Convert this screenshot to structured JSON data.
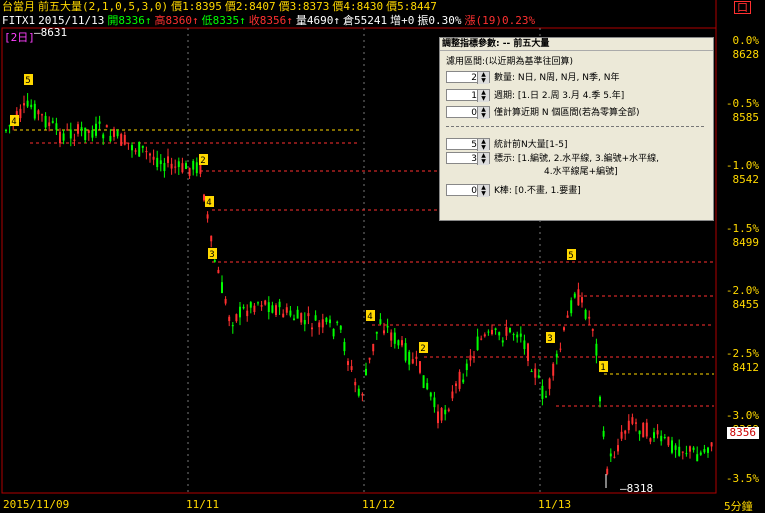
{
  "header": {
    "line1": [
      {
        "text": "台當月",
        "color": "#ffd800"
      },
      {
        "text": "前五大量(2,1,0,5,3,0)",
        "color": "#ffd800"
      },
      {
        "text": "價1:8395",
        "color": "#ffd800"
      },
      {
        "text": "價2:8407",
        "color": "#ffd800"
      },
      {
        "text": "價3:8373",
        "color": "#ffd800"
      },
      {
        "text": "價4:8430",
        "color": "#ffd800"
      },
      {
        "text": "價5:8447",
        "color": "#ffd800"
      }
    ],
    "line2": [
      {
        "text": "FITX1",
        "color": "#ffffff"
      },
      {
        "text": "2015/11/13",
        "color": "#ffffff"
      },
      {
        "text": "開8336↑",
        "color": "#00ff00"
      },
      {
        "text": "高8360↑",
        "color": "#ff3030"
      },
      {
        "text": "低8335↑",
        "color": "#00ff00"
      },
      {
        "text": "收8356↑",
        "color": "#ff3030"
      },
      {
        "text": "量4690↑",
        "color": "#ffffff"
      },
      {
        "text": "倉55241",
        "color": "#ffffff"
      },
      {
        "text": "增+0",
        "color": "#ffffff"
      },
      {
        "text": "振0.30%",
        "color": "#ffffff"
      },
      {
        "text": "漲(19)0.23%",
        "color": "#ff3030"
      }
    ],
    "tag": "[2日]",
    "high_mark": "8631"
  },
  "top_button": "口",
  "price_axis": [
    {
      "pct": "0.0%",
      "price": "8628"
    },
    {
      "pct": "-0.5%",
      "price": "8585"
    },
    {
      "pct": "-1.0%",
      "price": "8542"
    },
    {
      "pct": "-1.5%",
      "price": "8499"
    },
    {
      "pct": "-2.0%",
      "price": "8455"
    },
    {
      "pct": "-2.5%",
      "price": "8412"
    },
    {
      "pct": "-3.0%",
      "price": "8369"
    },
    {
      "pct": "-3.5%",
      "price": ""
    }
  ],
  "last_price": "8356",
  "low_mark": "8318",
  "x_axis": [
    "2015/11/09",
    "11/11",
    "11/12",
    "11/13"
  ],
  "timeframe": "5分鐘",
  "dialog": {
    "title": "調整指標參數: -- 前五大量",
    "section": "濾用區間:(以近期為基準往回算)",
    "params": [
      {
        "value": "2",
        "label": "數量: N日, N周, N月, N季, N年"
      },
      {
        "value": "1",
        "label": "週期: [1.日 2.周 3.月 4.季 5.年]"
      },
      {
        "value": "0",
        "label": "僅計算近期 N 個區間(若為零算全部)"
      },
      {
        "value": "5",
        "label": "統計前N大量[1-5]"
      },
      {
        "value": "3",
        "label": "標示: [1.編號, 2.水平線, 3.編號+水平線,"
      },
      {
        "value": "0",
        "label": "K棒: [0.不畫, 1.要畫]"
      }
    ],
    "param5_cont": "4.水平線尾+編號]"
  },
  "markers": [
    "1",
    "2",
    "3",
    "4",
    "5"
  ]
}
